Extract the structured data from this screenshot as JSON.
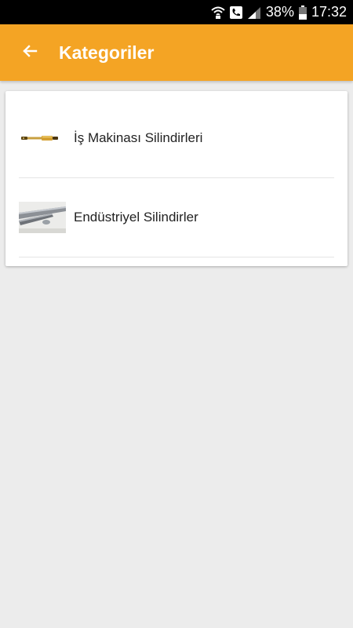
{
  "status_bar": {
    "battery": "38%",
    "time": "17:32",
    "icons": [
      "wifi-icon",
      "call-icon",
      "signal-icon",
      "battery-icon"
    ]
  },
  "app_bar": {
    "title": "Kategoriler",
    "back_icon": "arrow-left-icon",
    "color": "#f4a424"
  },
  "categories": [
    {
      "label": "İş Makinası Silindirleri",
      "thumbnail": "hydraulic-cylinder-gold"
    },
    {
      "label": "Endüstriyel Silindirler",
      "thumbnail": "industrial-cylinder-silver"
    }
  ]
}
